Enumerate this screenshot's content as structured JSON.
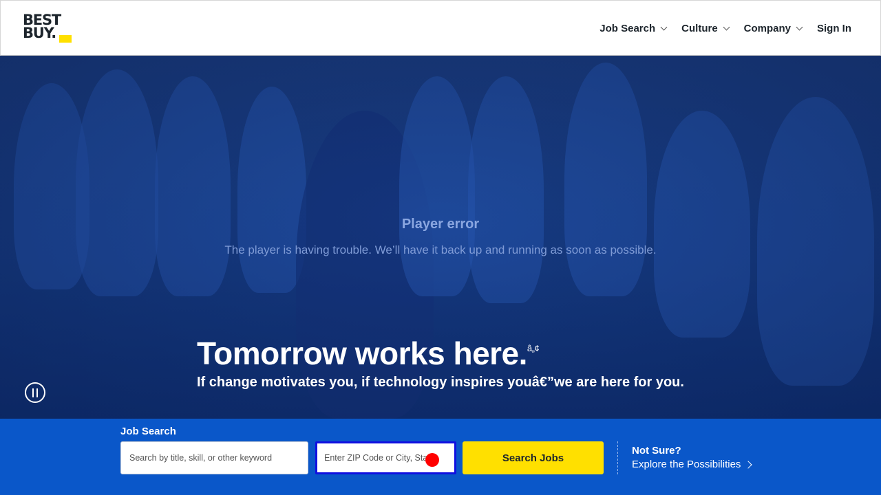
{
  "header": {
    "logo": {
      "line1": "BEST",
      "line2": "BUY."
    },
    "nav": [
      {
        "label": "Job Search",
        "has_dropdown": true
      },
      {
        "label": "Culture",
        "has_dropdown": true
      },
      {
        "label": "Company",
        "has_dropdown": true
      },
      {
        "label": "Sign In",
        "has_dropdown": false
      }
    ]
  },
  "hero": {
    "player_error_title": "Player error",
    "player_error_message": "The player is having trouble. We’ll have it back up and running as soon as possible.",
    "headline": "Tomorrow works here.",
    "headline_mark": "â„¢",
    "subheadline": "If change motivates you, if technology inspires youâ€”we are here for you.",
    "pause_icon": "pause-icon"
  },
  "search": {
    "label": "Job Search",
    "keyword_placeholder": "Search by title, skill, or other keyword",
    "location_placeholder": "Enter ZIP Code or City, State",
    "button_label": "Search Jobs",
    "not_sure": "Not Sure?",
    "explore_link": "Explore the Possibilities"
  },
  "colors": {
    "brand_blue": "#0a57c9",
    "brand_yellow": "#ffe000",
    "text_dark": "#1d252c",
    "hero_overlay": "#15397e"
  }
}
